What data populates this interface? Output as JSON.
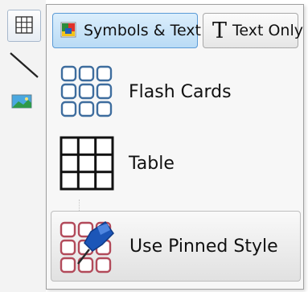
{
  "toolbar": {
    "tools": [
      {
        "name": "table-tool",
        "icon": "table-grid-icon"
      },
      {
        "name": "line-tool",
        "icon": "line-icon"
      },
      {
        "name": "image-tool",
        "icon": "picture-icon"
      }
    ]
  },
  "menu": {
    "mode_buttons": {
      "symbols_text": {
        "label": "Symbols & Text",
        "icon": "symbol-color-icon",
        "selected": true
      },
      "text_only": {
        "label": "Text Only",
        "icon": "serif-t-icon",
        "selected": false
      }
    },
    "items": [
      {
        "label": "Flash Cards",
        "icon": "flash-cards-grid-icon"
      },
      {
        "label": "Table",
        "icon": "table-grid-icon"
      },
      {
        "label": "Use Pinned Style",
        "icon": "pinned-grid-icon"
      }
    ]
  },
  "colors": {
    "selected_button_border": "#5a9ad6",
    "flash_cards_blue": "#3e6d9e",
    "pinned_red": "#b24a5a",
    "pin_blue": "#1c56b8"
  }
}
